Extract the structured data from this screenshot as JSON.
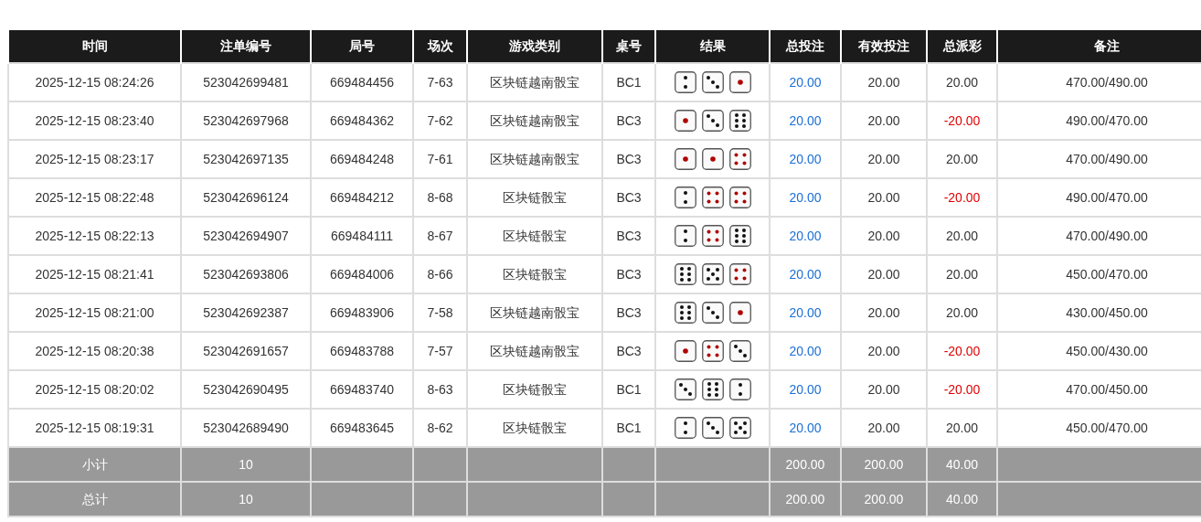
{
  "table": {
    "columns": [
      "时间",
      "注单编号",
      "局号",
      "场次",
      "游戏类别",
      "桌号",
      "结果",
      "总投注",
      "有效投注",
      "总派彩",
      "备注"
    ],
    "rows": [
      {
        "time": "2025-12-15 08:24:26",
        "bet_no": "523042699481",
        "round_no": "669484456",
        "session": "7-63",
        "game": "区块链越南骰宝",
        "table": "BC1",
        "dice": [
          {
            "kind": "two"
          },
          {
            "kind": "three"
          },
          {
            "kind": "one"
          }
        ],
        "total_bet": "20.00",
        "valid_bet": "20.00",
        "payout": "20.00",
        "payout_negative": false,
        "note": "470.00/490.00"
      },
      {
        "time": "2025-12-15 08:23:40",
        "bet_no": "523042697968",
        "round_no": "669484362",
        "session": "7-62",
        "game": "区块链越南骰宝",
        "table": "BC3",
        "dice": [
          {
            "kind": "one"
          },
          {
            "kind": "three"
          },
          {
            "kind": "six"
          }
        ],
        "total_bet": "20.00",
        "valid_bet": "20.00",
        "payout": "-20.00",
        "payout_negative": true,
        "note": "490.00/470.00"
      },
      {
        "time": "2025-12-15 08:23:17",
        "bet_no": "523042697135",
        "round_no": "669484248",
        "session": "7-61",
        "game": "区块链越南骰宝",
        "table": "BC3",
        "dice": [
          {
            "kind": "one"
          },
          {
            "kind": "one"
          },
          {
            "kind": "four"
          }
        ],
        "total_bet": "20.00",
        "valid_bet": "20.00",
        "payout": "20.00",
        "payout_negative": false,
        "note": "470.00/490.00"
      },
      {
        "time": "2025-12-15 08:22:48",
        "bet_no": "523042696124",
        "round_no": "669484212",
        "session": "8-68",
        "game": "区块链骰宝",
        "table": "BC3",
        "dice": [
          {
            "kind": "two"
          },
          {
            "kind": "four"
          },
          {
            "kind": "four"
          }
        ],
        "total_bet": "20.00",
        "valid_bet": "20.00",
        "payout": "-20.00",
        "payout_negative": true,
        "note": "490.00/470.00"
      },
      {
        "time": "2025-12-15 08:22:13",
        "bet_no": "523042694907",
        "round_no": "669484111",
        "session": "8-67",
        "game": "区块链骰宝",
        "table": "BC3",
        "dice": [
          {
            "kind": "two"
          },
          {
            "kind": "four"
          },
          {
            "kind": "six"
          }
        ],
        "total_bet": "20.00",
        "valid_bet": "20.00",
        "payout": "20.00",
        "payout_negative": false,
        "note": "470.00/490.00"
      },
      {
        "time": "2025-12-15 08:21:41",
        "bet_no": "523042693806",
        "round_no": "669484006",
        "session": "8-66",
        "game": "区块链骰宝",
        "table": "BC3",
        "dice": [
          {
            "kind": "six"
          },
          {
            "kind": "five"
          },
          {
            "kind": "four"
          }
        ],
        "total_bet": "20.00",
        "valid_bet": "20.00",
        "payout": "20.00",
        "payout_negative": false,
        "note": "450.00/470.00"
      },
      {
        "time": "2025-12-15 08:21:00",
        "bet_no": "523042692387",
        "round_no": "669483906",
        "session": "7-58",
        "game": "区块链越南骰宝",
        "table": "BC3",
        "dice": [
          {
            "kind": "six"
          },
          {
            "kind": "three"
          },
          {
            "kind": "one"
          }
        ],
        "total_bet": "20.00",
        "valid_bet": "20.00",
        "payout": "20.00",
        "payout_negative": false,
        "note": "430.00/450.00"
      },
      {
        "time": "2025-12-15 08:20:38",
        "bet_no": "523042691657",
        "round_no": "669483788",
        "session": "7-57",
        "game": "区块链越南骰宝",
        "table": "BC3",
        "dice": [
          {
            "kind": "one"
          },
          {
            "kind": "four"
          },
          {
            "kind": "three"
          }
        ],
        "total_bet": "20.00",
        "valid_bet": "20.00",
        "payout": "-20.00",
        "payout_negative": true,
        "note": "450.00/430.00"
      },
      {
        "time": "2025-12-15 08:20:02",
        "bet_no": "523042690495",
        "round_no": "669483740",
        "session": "8-63",
        "game": "区块链骰宝",
        "table": "BC1",
        "dice": [
          {
            "kind": "three"
          },
          {
            "kind": "six"
          },
          {
            "kind": "two"
          }
        ],
        "total_bet": "20.00",
        "valid_bet": "20.00",
        "payout": "-20.00",
        "payout_negative": true,
        "note": "470.00/450.00"
      },
      {
        "time": "2025-12-15 08:19:31",
        "bet_no": "523042689490",
        "round_no": "669483645",
        "session": "8-62",
        "game": "区块链骰宝",
        "table": "BC1",
        "dice": [
          {
            "kind": "two"
          },
          {
            "kind": "three"
          },
          {
            "kind": "five"
          }
        ],
        "total_bet": "20.00",
        "valid_bet": "20.00",
        "payout": "20.00",
        "payout_negative": false,
        "note": "450.00/470.00"
      }
    ],
    "summary": [
      {
        "label": "小计",
        "count": "10",
        "total_bet": "200.00",
        "valid_bet": "200.00",
        "payout": "40.00"
      },
      {
        "label": "总计",
        "count": "10",
        "total_bet": "200.00",
        "valid_bet": "200.00",
        "payout": "40.00"
      }
    ]
  }
}
